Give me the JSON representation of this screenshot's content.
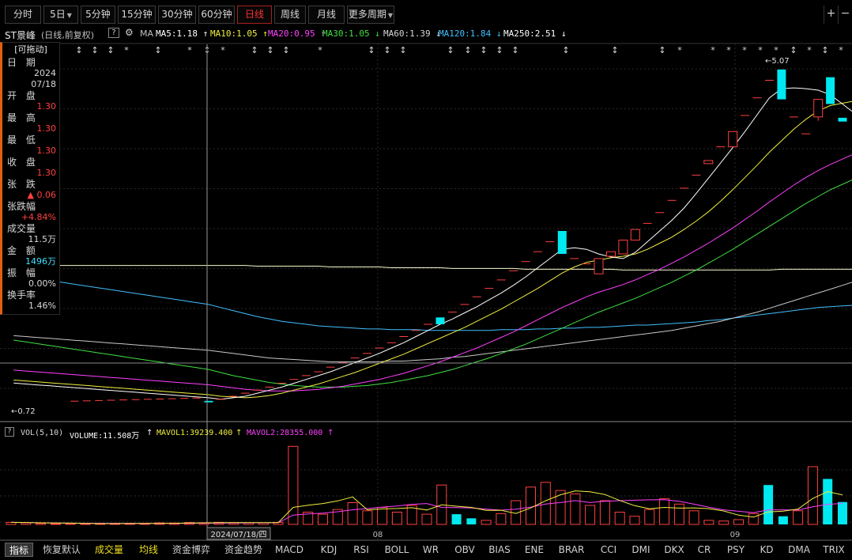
{
  "toolbar": {
    "periods": [
      {
        "label": "分时"
      },
      {
        "label": "5日",
        "has_dropdown": true
      },
      {
        "label": "5分钟"
      },
      {
        "label": "15分钟"
      },
      {
        "label": "30分钟"
      },
      {
        "label": "60分钟"
      },
      {
        "label": "日线",
        "active": true
      },
      {
        "label": "周线"
      },
      {
        "label": "月线"
      },
      {
        "label": "更多周期",
        "has_dropdown": true
      }
    ],
    "right_icons": [
      "plus-icon",
      "minus-icon"
    ]
  },
  "stock": {
    "name": "ST景峰",
    "mode": "(日线,前复权)",
    "help": "?",
    "settings_icon": "gear-icon",
    "ma_label": "MA"
  },
  "ma_legend": [
    {
      "text": "MA5:1.18",
      "arrow": "↑",
      "color": "#ffffff"
    },
    {
      "text": "MA10:1.05",
      "arrow": "↑",
      "color": "#f0f040"
    },
    {
      "text": "MA20:0.95",
      "arrow": "↑",
      "color": "#ff40ff"
    },
    {
      "text": "MA30:1.05",
      "arrow": "↓",
      "color": "#40e040"
    },
    {
      "text": "MA60:1.39",
      "arrow": "↓",
      "color": "#d8d8d8"
    },
    {
      "text": "MA120:1.84",
      "arrow": "↓",
      "color": "#40c0ff"
    },
    {
      "text": "MA250:2.51",
      "arrow": "↓",
      "color": "#ffffff"
    }
  ],
  "info_panel": {
    "header": "[可拖动]",
    "rows": [
      {
        "label": "日 期",
        "value": "2024\n07/18",
        "color": "#d8d8d8"
      },
      {
        "label": "开 盘",
        "value": "1.30",
        "color": "#ff4040"
      },
      {
        "label": "最 高",
        "value": "1.30",
        "color": "#ff4040"
      },
      {
        "label": "最 低",
        "value": "1.30",
        "color": "#ff4040"
      },
      {
        "label": "收 盘",
        "value": "1.30",
        "color": "#ff4040"
      },
      {
        "label": "张 跌",
        "value": "▲ 0.06",
        "color": "#ff4040"
      },
      {
        "label": "张跌幅",
        "value": "+4.84%",
        "color": "#ff4040"
      },
      {
        "label": "成交量",
        "value": "11.5万",
        "color": "#d8d8d8"
      },
      {
        "label": "金 额",
        "value": "1496万",
        "color": "#40e0ff"
      },
      {
        "label": "振 幅",
        "value": "0.00%",
        "color": "#d8d8d8"
      },
      {
        "label": "换手率",
        "value": "1.46%",
        "color": "#d8d8d8"
      }
    ]
  },
  "price_annotations": {
    "high": "5.07",
    "low": "0.72"
  },
  "crosshair_date": "2024/07/18/四",
  "month_labels": [
    "08",
    "09"
  ],
  "volume_legend": {
    "name": "VOL(5,10)",
    "volume": "VOLUME:11.508万",
    "vol_arrow": "↑",
    "mavol1": "MAVOL1:39239.400",
    "mavol1_arrow": "↑",
    "mavol2": "MAVOL2:28355.000",
    "mavol2_arrow": "↑"
  },
  "bottom_tabs": [
    {
      "label": "指标",
      "selected": true
    },
    {
      "label": "恢复默认"
    },
    {
      "label": "成交量",
      "yellow": true
    },
    {
      "label": "均线",
      "yellow": true
    },
    {
      "label": "资金博弈"
    },
    {
      "label": "资金趋势"
    },
    {
      "label": "MACD"
    },
    {
      "label": "KDJ"
    },
    {
      "label": "RSI"
    },
    {
      "label": "BOLL"
    },
    {
      "label": "WR"
    },
    {
      "label": "OBV"
    },
    {
      "label": "BIAS"
    },
    {
      "label": "ENE"
    },
    {
      "label": "BRAR"
    },
    {
      "label": "CCI"
    },
    {
      "label": "DMI"
    },
    {
      "label": "DKX"
    },
    {
      "label": "CR"
    },
    {
      "label": "PSY"
    },
    {
      "label": "KD"
    },
    {
      "label": "DMA"
    },
    {
      "label": "TRIX"
    }
  ],
  "chart_data": {
    "type": "candlestick",
    "price_range": [
      0.5,
      5.4
    ],
    "candles": [
      {
        "o": 0.74,
        "h": 0.74,
        "l": 0.72,
        "c": 0.72
      },
      {
        "o": 0.76,
        "h": 0.76,
        "l": 0.76,
        "c": 0.76
      },
      {
        "o": 0.8,
        "h": 0.8,
        "l": 0.8,
        "c": 0.8
      },
      {
        "o": 0.84,
        "h": 0.84,
        "l": 0.84,
        "c": 0.84
      },
      {
        "o": 0.88,
        "h": 0.88,
        "l": 0.88,
        "c": 0.88
      },
      {
        "o": 0.92,
        "h": 0.92,
        "l": 0.92,
        "c": 0.92
      },
      {
        "o": 0.97,
        "h": 0.97,
        "l": 0.97,
        "c": 0.97
      },
      {
        "o": 1.02,
        "h": 1.02,
        "l": 1.02,
        "c": 1.02
      },
      {
        "o": 1.07,
        "h": 1.07,
        "l": 1.07,
        "c": 1.07
      },
      {
        "o": 1.12,
        "h": 1.12,
        "l": 1.12,
        "c": 1.12
      },
      {
        "o": 1.18,
        "h": 1.18,
        "l": 1.18,
        "c": 1.18
      },
      {
        "o": 1.24,
        "h": 1.24,
        "l": 1.24,
        "c": 1.24
      },
      {
        "o": 1.3,
        "h": 1.3,
        "l": 1.3,
        "c": 1.3
      },
      {
        "o": 1.36,
        "h": 1.36,
        "l": 1.36,
        "c": 1.36
      },
      {
        "o": 1.43,
        "h": 1.43,
        "l": 1.43,
        "c": 1.43
      },
      {
        "o": 1.5,
        "h": 1.5,
        "l": 1.5,
        "c": 1.5
      },
      {
        "o": 1.58,
        "h": 1.58,
        "l": 1.58,
        "c": 1.58
      },
      {
        "o": 1.66,
        "h": 1.66,
        "l": 1.66,
        "c": 1.66
      },
      {
        "o": 1.74,
        "h": 1.74,
        "l": 1.74,
        "c": 1.74
      },
      {
        "o": 1.83,
        "h": 1.83,
        "l": 1.74,
        "c": 1.74
      },
      {
        "o": 1.9,
        "h": 1.9,
        "l": 1.9,
        "c": 1.9
      },
      {
        "o": 2.0,
        "h": 2.0,
        "l": 2.0,
        "c": 2.0
      },
      {
        "o": 2.1,
        "h": 2.1,
        "l": 2.1,
        "c": 2.1
      },
      {
        "o": 2.21,
        "h": 2.21,
        "l": 2.21,
        "c": 2.21
      },
      {
        "o": 2.32,
        "h": 2.32,
        "l": 2.32,
        "c": 2.32
      },
      {
        "o": 2.44,
        "h": 2.44,
        "l": 2.44,
        "c": 2.44
      },
      {
        "o": 2.56,
        "h": 2.56,
        "l": 2.56,
        "c": 2.56
      },
      {
        "o": 2.69,
        "h": 2.69,
        "l": 2.69,
        "c": 2.69
      },
      {
        "o": 2.82,
        "h": 2.82,
        "l": 2.82,
        "c": 2.82
      },
      {
        "o": 2.96,
        "h": 2.96,
        "l": 2.66,
        "c": 2.66
      },
      {
        "o": 2.6,
        "h": 2.6,
        "l": 2.6,
        "c": 2.6
      },
      {
        "o": 2.53,
        "h": 2.53,
        "l": 2.53,
        "c": 2.53
      },
      {
        "o": 2.4,
        "h": 2.6,
        "l": 2.4,
        "c": 2.6
      },
      {
        "o": 2.63,
        "h": 2.69,
        "l": 2.63,
        "c": 2.69
      },
      {
        "o": 2.66,
        "h": 2.84,
        "l": 2.66,
        "c": 2.84
      },
      {
        "o": 2.84,
        "h": 2.98,
        "l": 2.84,
        "c": 2.98
      },
      {
        "o": 3.06,
        "h": 3.06,
        "l": 3.06,
        "c": 3.06
      },
      {
        "o": 3.2,
        "h": 3.2,
        "l": 3.2,
        "c": 3.2
      },
      {
        "o": 3.36,
        "h": 3.36,
        "l": 3.36,
        "c": 3.36
      },
      {
        "o": 3.52,
        "h": 3.52,
        "l": 3.52,
        "c": 3.52
      },
      {
        "o": 3.69,
        "h": 3.69,
        "l": 3.69,
        "c": 3.69
      },
      {
        "o": 3.84,
        "h": 3.88,
        "l": 3.84,
        "c": 3.88
      },
      {
        "o": 4.06,
        "h": 4.06,
        "l": 4.06,
        "c": 4.06
      },
      {
        "o": 4.06,
        "h": 4.26,
        "l": 4.06,
        "c": 4.26
      },
      {
        "o": 4.47,
        "h": 4.47,
        "l": 4.47,
        "c": 4.47
      },
      {
        "o": 4.7,
        "h": 4.7,
        "l": 4.7,
        "c": 4.7
      },
      {
        "o": 4.93,
        "h": 4.93,
        "l": 4.93,
        "c": 4.93
      },
      {
        "o": 5.07,
        "h": 5.07,
        "l": 4.68,
        "c": 4.68
      },
      {
        "o": 4.45,
        "h": 4.45,
        "l": 4.45,
        "c": 4.45
      },
      {
        "o": 4.23,
        "h": 4.23,
        "l": 4.23,
        "c": 4.23
      },
      {
        "o": 4.45,
        "h": 4.68,
        "l": 4.4,
        "c": 4.68
      },
      {
        "o": 4.97,
        "h": 4.97,
        "l": 4.62,
        "c": 4.62
      },
      {
        "o": 4.44,
        "h": 4.44,
        "l": 4.39,
        "c": 4.39
      }
    ],
    "volume_range": [
      0,
      120000
    ],
    "volumes": [
      3000,
      2500,
      1500,
      1000,
      1200,
      1100,
      1300,
      1200,
      1400,
      1600,
      2200,
      2000,
      2800,
      2500,
      3000,
      2600,
      2400,
      2500,
      3000,
      115000,
      18000,
      15000,
      22000,
      32000,
      20000,
      25000,
      18000,
      28000,
      15000,
      58000,
      15000,
      9000,
      6000,
      16000,
      35000,
      55000,
      62000,
      50000,
      45000,
      28000,
      35000,
      18000,
      12000,
      22000,
      38000,
      30000,
      20000,
      6000,
      5000,
      7000,
      16000,
      58000,
      12000,
      20000,
      85000,
      67000,
      33000
    ],
    "volume_colors": [
      "r",
      "r",
      "r",
      "r",
      "r",
      "r",
      "r",
      "r",
      "r",
      "r",
      "r",
      "r",
      "r",
      "r",
      "r",
      "r",
      "r",
      "r",
      "r",
      "r",
      "r",
      "r",
      "r",
      "r",
      "r",
      "r",
      "r",
      "r",
      "r",
      "r",
      "c",
      "c",
      "r",
      "r",
      "r",
      "r",
      "r",
      "r",
      "r",
      "r",
      "r",
      "r",
      "r",
      "r",
      "r",
      "r",
      "r",
      "r",
      "r",
      "r",
      "r",
      "c",
      "c",
      "r",
      "r",
      "c",
      "c"
    ],
    "ma_series": {
      "MA5": {
        "color": "#ffffff",
        "values": [
          0.78,
          0.76,
          0.78,
          0.8,
          0.84,
          0.88,
          0.92,
          0.97,
          1.02,
          1.07,
          1.12,
          1.18,
          1.24,
          1.3,
          1.36,
          1.43,
          1.5,
          1.58,
          1.66,
          1.74,
          1.81,
          1.89,
          1.97,
          2.06,
          2.15,
          2.25,
          2.36,
          2.48,
          2.6,
          2.72,
          2.74,
          2.72,
          2.66,
          2.62,
          2.6,
          2.68,
          2.82,
          2.96,
          3.1,
          3.26,
          3.45,
          3.65,
          3.85,
          4.05,
          4.26,
          4.48,
          4.7,
          4.82,
          4.83,
          4.82,
          4.8,
          4.74,
          4.62
        ]
      },
      "MA10": {
        "color": "#f0f040",
        "values": [
          0.82,
          0.8,
          0.79,
          0.78,
          0.79,
          0.81,
          0.84,
          0.88,
          0.92,
          0.96,
          1.01,
          1.06,
          1.11,
          1.17,
          1.23,
          1.29,
          1.35,
          1.42,
          1.49,
          1.56,
          1.63,
          1.7,
          1.78,
          1.86,
          1.94,
          2.03,
          2.12,
          2.21,
          2.31,
          2.41,
          2.49,
          2.55,
          2.58,
          2.61,
          2.63,
          2.66,
          2.72,
          2.8,
          2.88,
          2.98,
          3.09,
          3.21,
          3.35,
          3.5,
          3.66,
          3.82,
          3.99,
          4.14,
          4.29,
          4.42,
          4.53,
          4.6,
          4.63
        ]
      },
      "MA20": {
        "color": "#ff40ff",
        "values": [
          0.95,
          0.93,
          0.91,
          0.89,
          0.88,
          0.87,
          0.87,
          0.87,
          0.88,
          0.89,
          0.91,
          0.93,
          0.96,
          0.99,
          1.02,
          1.06,
          1.1,
          1.15,
          1.2,
          1.25,
          1.31,
          1.37,
          1.43,
          1.5,
          1.57,
          1.64,
          1.72,
          1.8,
          1.88,
          1.96,
          2.03,
          2.1,
          2.16,
          2.21,
          2.26,
          2.32,
          2.39,
          2.46,
          2.54,
          2.62,
          2.71,
          2.8,
          2.9,
          3.0,
          3.11,
          3.22,
          3.34,
          3.45,
          3.56,
          3.66,
          3.75,
          3.83,
          3.9
        ]
      },
      "MA30": {
        "color": "#40e040",
        "values": [
          1.15,
          1.11,
          1.07,
          1.04,
          1.01,
          0.98,
          0.96,
          0.94,
          0.93,
          0.92,
          0.92,
          0.92,
          0.93,
          0.94,
          0.96,
          0.98,
          1.01,
          1.04,
          1.07,
          1.11,
          1.15,
          1.2,
          1.25,
          1.3,
          1.36,
          1.42,
          1.48,
          1.55,
          1.62,
          1.69,
          1.76,
          1.83,
          1.9,
          1.96,
          2.02,
          2.08,
          2.15,
          2.22,
          2.29,
          2.37,
          2.45,
          2.54,
          2.63,
          2.72,
          2.82,
          2.92,
          3.02,
          3.12,
          3.22,
          3.32,
          3.41,
          3.5,
          3.57
        ]
      },
      "MA60": {
        "color": "#c8c8c8",
        "values": [
          1.4,
          1.38,
          1.36,
          1.34,
          1.32,
          1.3,
          1.29,
          1.28,
          1.27,
          1.26,
          1.25,
          1.25,
          1.25,
          1.25,
          1.25,
          1.26,
          1.26,
          1.27,
          1.28,
          1.29,
          1.31,
          1.32,
          1.34,
          1.36,
          1.38,
          1.4,
          1.42,
          1.44,
          1.46,
          1.48,
          1.5,
          1.52,
          1.54,
          1.56,
          1.58,
          1.6,
          1.62,
          1.64,
          1.66,
          1.69,
          1.72,
          1.75,
          1.78,
          1.82,
          1.86,
          1.9,
          1.95,
          2.0,
          2.05,
          2.1,
          2.15,
          2.2,
          2.25
        ]
      },
      "MA120": {
        "color": "#40c0ff",
        "values": [
          2.0,
          1.96,
          1.92,
          1.88,
          1.84,
          1.81,
          1.78,
          1.76,
          1.74,
          1.72,
          1.71,
          1.7,
          1.69,
          1.68,
          1.68,
          1.67,
          1.67,
          1.67,
          1.66,
          1.66,
          1.66,
          1.66,
          1.66,
          1.66,
          1.67,
          1.67,
          1.67,
          1.68,
          1.68,
          1.69,
          1.69,
          1.7,
          1.7,
          1.71,
          1.72,
          1.73,
          1.73,
          1.74,
          1.75,
          1.76,
          1.77,
          1.79,
          1.8,
          1.82,
          1.84,
          1.86,
          1.88,
          1.9,
          1.92,
          1.94,
          1.96,
          1.97,
          1.98
        ]
      },
      "MA250": {
        "color": "#f8f8c8",
        "values": [
          2.51,
          2.51,
          2.51,
          2.51,
          2.5,
          2.5,
          2.5,
          2.5,
          2.5,
          2.5,
          2.49,
          2.49,
          2.49,
          2.49,
          2.49,
          2.48,
          2.48,
          2.48,
          2.48,
          2.48,
          2.47,
          2.47,
          2.47,
          2.47,
          2.47,
          2.47,
          2.46,
          2.46,
          2.46,
          2.46,
          2.46,
          2.46,
          2.46,
          2.46,
          2.45,
          2.45,
          2.45,
          2.45,
          2.45,
          2.45,
          2.45,
          2.45,
          2.45,
          2.45,
          2.45,
          2.45,
          2.45,
          2.46,
          2.46,
          2.46,
          2.46,
          2.46,
          2.46
        ]
      }
    },
    "mavol": {
      "MAVOL1": {
        "color": "#f0f040"
      },
      "MAVOL2": {
        "color": "#ff40ff"
      }
    }
  }
}
